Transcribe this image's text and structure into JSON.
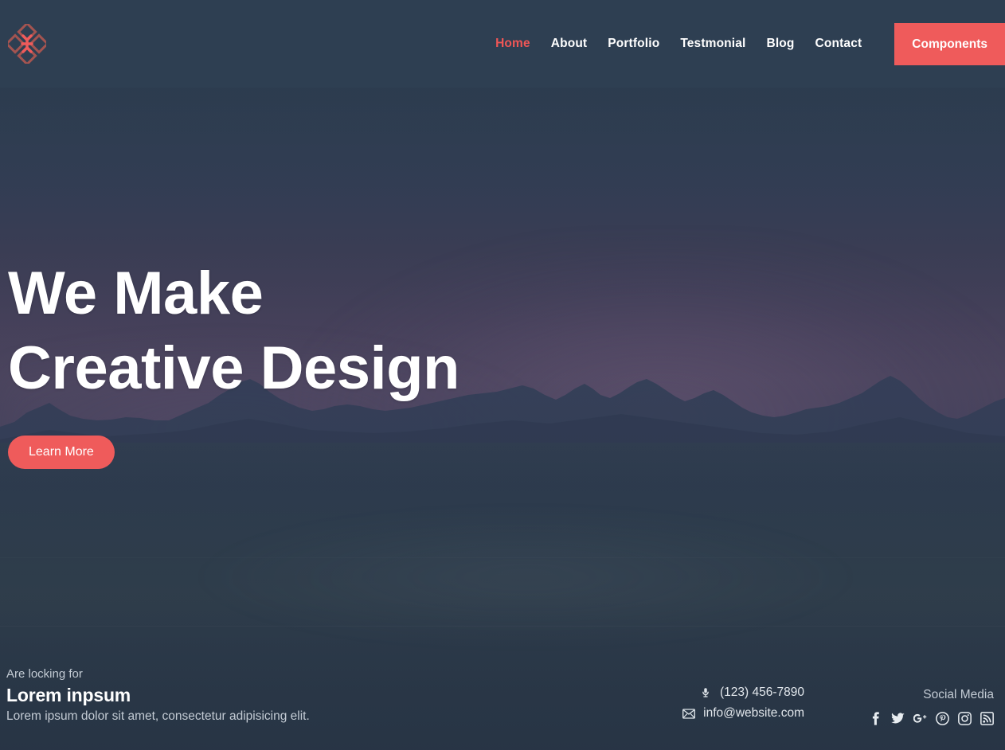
{
  "site": {
    "logo_icon": "diamond-petals-logo",
    "accent_color": "#ef5b5b",
    "background_color": "#2e3f52",
    "text_color": "#ffffff"
  },
  "header": {
    "nav": [
      {
        "label": "Home",
        "active": true,
        "name": "nav-link-home"
      },
      {
        "label": "About",
        "active": false,
        "name": "nav-link-about"
      },
      {
        "label": "Portfolio",
        "active": false,
        "name": "nav-link-portfolio"
      },
      {
        "label": "Testmonial",
        "active": false,
        "name": "nav-link-testmonial"
      },
      {
        "label": "Blog",
        "active": false,
        "name": "nav-link-blog"
      },
      {
        "label": "Contact",
        "active": false,
        "name": "nav-link-contact"
      }
    ],
    "cta_button": "Components"
  },
  "hero": {
    "title_line1": "We Make",
    "title_line2": "Creative Design",
    "cta_button": "Learn More"
  },
  "footer": {
    "eyebrow": "Are locking for",
    "heading": "Lorem inpsum",
    "subtext": "Lorem ipsum dolor sit amet, consectetur adipisicing elit.",
    "contact": {
      "phone": "(123) 456-7890",
      "phone_icon": "phone-icon",
      "email": "info@website.com",
      "email_icon": "envelope-icon"
    },
    "social": {
      "label": "Social Media",
      "items": [
        {
          "name": "facebook-icon",
          "glyph": "f"
        },
        {
          "name": "twitter-icon",
          "glyph": "t"
        },
        {
          "name": "googleplus-icon",
          "glyph": "g+"
        },
        {
          "name": "pinterest-icon",
          "glyph": "p"
        },
        {
          "name": "instagram-icon",
          "glyph": "ig"
        },
        {
          "name": "rss-icon",
          "glyph": "rss"
        }
      ]
    }
  }
}
